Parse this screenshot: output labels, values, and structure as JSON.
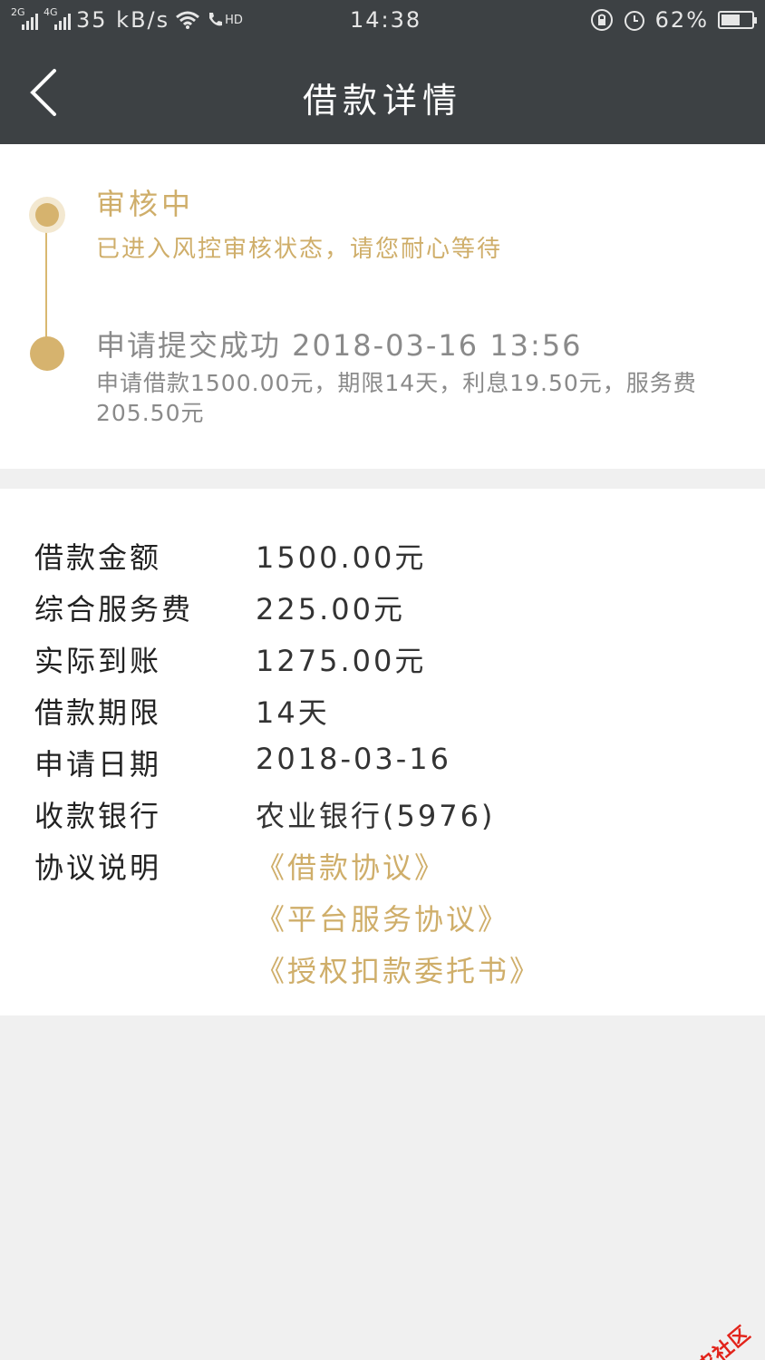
{
  "status_bar": {
    "network_1": "2G",
    "network_2": "4G",
    "speed": "35 kB/s",
    "call_label": "HD",
    "time": "14:38",
    "battery": "62%",
    "battery_level": 0.62
  },
  "header": {
    "title": "借款详情"
  },
  "timeline": [
    {
      "title": "审核中",
      "desc": "已进入风控审核状态，请您耐心等待"
    },
    {
      "title": "申请提交成功 2018-03-16 13:56",
      "desc": "申请借款1500.00元，期限14天，利息19.50元，服务费205.50元"
    }
  ],
  "details": [
    {
      "label": "借款金额",
      "value": "1500.00元"
    },
    {
      "label": "综合服务费",
      "value": "225.00元"
    },
    {
      "label": "实际到账",
      "value": "1275.00元"
    },
    {
      "label": "借款期限",
      "value": "14天"
    },
    {
      "label": "申请日期",
      "value": "2018-03-16"
    },
    {
      "label": "收款银行",
      "value": "农业银行(5976)"
    }
  ],
  "agreements": {
    "label": "协议说明",
    "links": [
      "《借款协议》",
      "《平台服务协议》",
      "《授权扣款委托书》"
    ]
  },
  "watermark": {
    "text": "卡农社区"
  },
  "colors": {
    "header_bg": "#3d4144",
    "accent_gold": "#cfae6a",
    "page_bg": "#f0f0f0"
  }
}
